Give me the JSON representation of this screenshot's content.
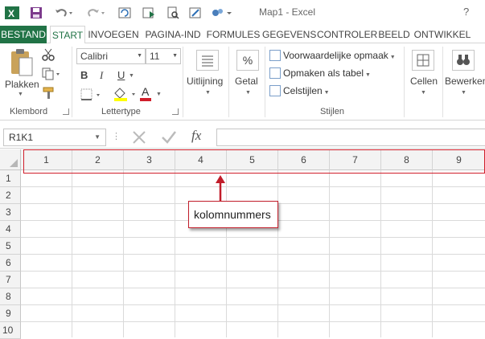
{
  "window": {
    "title": "Map1 - Excel",
    "help": "?"
  },
  "tabs": [
    "BESTAND",
    "START",
    "INVOEGEN",
    "PAGINA-IND",
    "FORMULES",
    "GEGEVENS",
    "CONTROLER",
    "BEELD",
    "ONTWIKKEL"
  ],
  "ribbon": {
    "clipboard": {
      "paste_label": "Plakken",
      "group_label": "Klembord"
    },
    "font": {
      "font_name": "Calibri",
      "font_size": "11",
      "bold": "B",
      "italic": "I",
      "underline": "U",
      "font_color_glyph": "A",
      "group_label": "Lettertype"
    },
    "alignment": {
      "label": "Uitlijning"
    },
    "number": {
      "label": "Getal",
      "glyph": "%"
    },
    "styles": {
      "items": [
        "Voorwaardelijke opmaak",
        "Opmaken als tabel",
        "Celstijlen"
      ],
      "group_label": "Stijlen"
    },
    "cells": {
      "label": "Cellen"
    },
    "editing": {
      "label": "Bewerken"
    }
  },
  "formula_bar": {
    "name_box": "R1K1",
    "fx": "fx",
    "value": ""
  },
  "grid": {
    "column_headers": [
      "1",
      "2",
      "3",
      "4",
      "5",
      "6",
      "7",
      "8",
      "9"
    ],
    "row_headers": [
      "1",
      "2",
      "3",
      "4",
      "5",
      "6",
      "7",
      "8",
      "9",
      "10"
    ]
  },
  "annotation": {
    "callout_text": "kolomnummers"
  },
  "colors": {
    "excel_green": "#217346",
    "annotation_red": "#d01e2a"
  }
}
